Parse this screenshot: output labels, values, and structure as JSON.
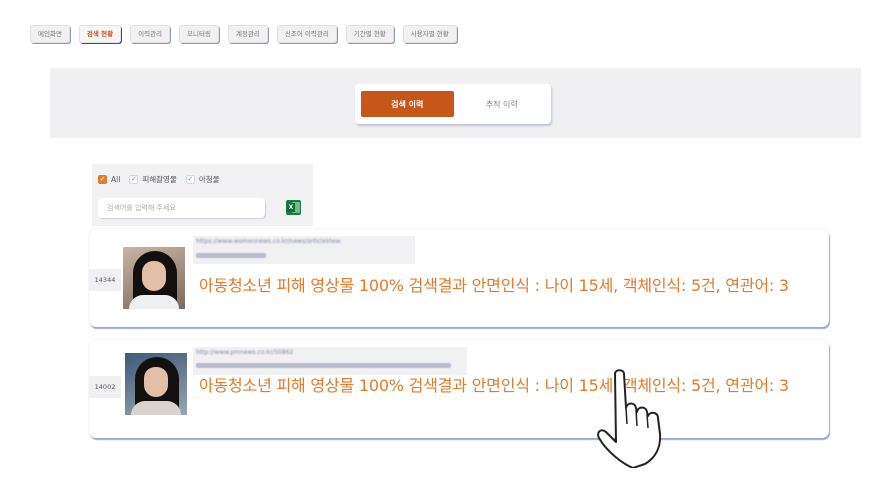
{
  "nav": {
    "items": [
      {
        "label": "메인화면",
        "active": false
      },
      {
        "label": "검색 현황",
        "active": true
      },
      {
        "label": "이력관리",
        "active": false
      },
      {
        "label": "모니터링",
        "active": false
      },
      {
        "label": "계정관리",
        "active": false
      },
      {
        "label": "신조어 이력관리",
        "active": false
      },
      {
        "label": "기간별 현황",
        "active": false
      },
      {
        "label": "사용자별 현황",
        "active": false
      }
    ]
  },
  "toggle": {
    "search_history": "검색 이력",
    "tracking_history": "추적 이력"
  },
  "filter": {
    "all_label": "All",
    "victim_video_label": "피해촬영물",
    "child_label": "아청물",
    "search_placeholder": "검색어를 입력해 주세요",
    "excel_icon": "excel-icon"
  },
  "results": [
    {
      "id": "14344",
      "url": "https://www.womennews.co.kr/news/articleView.",
      "headline": "아동청소년 피해 영상물 100% 검색결과  안면인식 : 나이 15세, 객체인식: 5건, 연관어: 3"
    },
    {
      "id": "14002",
      "url": "http://www.pmnews.co.kr/50862",
      "headline": "아동청소년 피해 영상물 100% 검색결과  안면인식 : 나이 15세, 객체인식: 5건, 연관어: 3"
    }
  ],
  "colors": {
    "accent": "#c7561a",
    "headline": "#e07a2c",
    "card_shadow": "#93a8d2"
  }
}
